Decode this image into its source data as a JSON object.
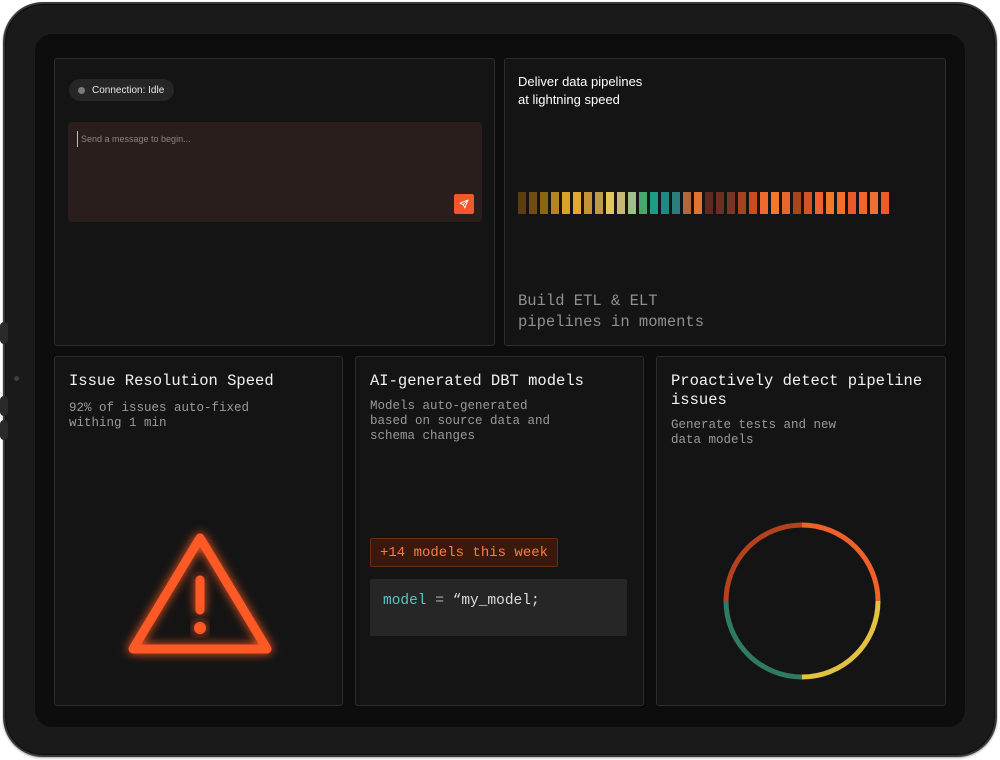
{
  "chat_panel": {
    "connection_status": "Connection: Idle",
    "message_placeholder": "Send a message to begin...",
    "send_icon": "send-icon"
  },
  "pipeline_panel": {
    "title_line1": "Deliver data pipelines",
    "title_line2": "at lightning speed",
    "subtitle_line1": "Build ETL & ELT",
    "subtitle_line2": "pipelines in moments",
    "bar_colors": [
      "#5a3d12",
      "#6e4e16",
      "#8a6418",
      "#b5861d",
      "#d9a325",
      "#e0aa2c",
      "#c49334",
      "#bb9a4a",
      "#e2c65a",
      "#c9b77a",
      "#9fbf85",
      "#44a96f",
      "#1f9a84",
      "#1d8a87",
      "#2a7d7a",
      "#b06a38",
      "#e0742f",
      "#5e2a1f",
      "#6b2f22",
      "#7a3424",
      "#a4441f",
      "#cc4b22",
      "#f06a2d",
      "#f2792b",
      "#e8662a",
      "#a6461f",
      "#d0532a",
      "#f0612c",
      "#f07a2c",
      "#f26f2c",
      "#e85a2a",
      "#f2652c",
      "#f07030",
      "#f05a2a"
    ]
  },
  "cards": {
    "resolution": {
      "title": "Issue Resolution Speed",
      "description": "92% of issues auto-fixed\nwithing 1 min",
      "icon": "warning-icon",
      "accent_color": "#ff5a28"
    },
    "dbt": {
      "title": "AI-generated DBT models",
      "description": "Models auto-generated\nbased on source data and\nschema changes",
      "badge": "+14 models this week",
      "code_keyword": "model",
      "code_operator": "=",
      "code_value": "“my_model;"
    },
    "detect": {
      "title": "Proactively detect pipeline issues",
      "description": "Generate tests and new\ndata models",
      "ring_colors": [
        "#f0602a",
        "#e3c241",
        "#2f7a63",
        "#b5421f"
      ]
    }
  }
}
